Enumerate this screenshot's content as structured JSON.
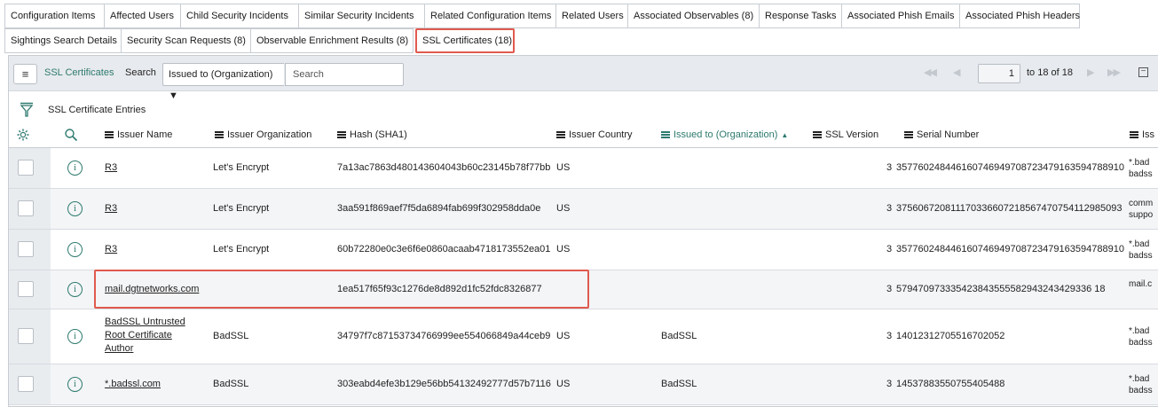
{
  "tabs_row1": [
    {
      "label": "Configuration Items",
      "w": 113
    },
    {
      "label": "Affected Users",
      "w": 86
    },
    {
      "label": "Child Security Incidents",
      "w": 133
    },
    {
      "label": "Similar Security Incidents",
      "w": 142
    },
    {
      "label": "Related Configuration Items",
      "w": 148
    },
    {
      "label": "Related Users",
      "w": 81
    },
    {
      "label": "Associated Observables (8)",
      "w": 148
    },
    {
      "label": "Response Tasks",
      "w": 93
    },
    {
      "label": "Associated Phish Emails",
      "w": 133
    },
    {
      "label": "Associated Phish Headers",
      "w": 135
    }
  ],
  "tabs_row2": [
    {
      "label": "Sightings Search Details",
      "w": 132
    },
    {
      "label": "Security Scan Requests (8)",
      "w": 146
    },
    {
      "label": "Observable Enrichment Results (8)",
      "w": 183
    },
    {
      "label": "SSL Certificates (18)",
      "w": 112,
      "active": true
    }
  ],
  "toolbar": {
    "list_title": "SSL Certificates",
    "search_label": "Search",
    "search_field": "Issued to (Organization)",
    "search_placeholder": "Search",
    "page_number": "1",
    "page_range": "to 18 of 18"
  },
  "list": {
    "entries_title": "SSL Certificate Entries",
    "columns": [
      "Issuer Name",
      "Issuer Organization",
      "Hash (SHA1)",
      "Issuer Country",
      "Issued to (Organization)",
      "SSL Version",
      "Serial Number",
      "Iss"
    ],
    "rows": [
      {
        "issuer_name": "R3",
        "issuer_org": "Let's Encrypt",
        "hash": "7a13ac7863d480143604043b60c23145b78f77bb",
        "country": "US",
        "issued_to": "",
        "version": "3",
        "serial": "357760248446160746949708723479163594788910",
        "extra": "*.bad\nbadss"
      },
      {
        "issuer_name": "R3",
        "issuer_org": "Let's Encrypt",
        "hash": "3aa591f869aef7f5da6894fab699f302958dda0e",
        "country": "US",
        "issued_to": "",
        "version": "3",
        "serial": "375606720811170336607218567470754112985093",
        "extra": "comm\nsuppo"
      },
      {
        "issuer_name": "R3",
        "issuer_org": "Let's Encrypt",
        "hash": "60b72280e0c3e6f6e0860acaab4718173552ea01",
        "country": "US",
        "issued_to": "",
        "version": "3",
        "serial": "357760248446160746949708723479163594788910",
        "extra": "*.bad\nbadss"
      },
      {
        "issuer_name": "mail.dgtnetworks.com",
        "issuer_org": "",
        "hash": "1ea517f65f93c1276de8d892d1fc52fdc8326877",
        "country": "",
        "issued_to": "",
        "version": "3",
        "serial": "579470973335423843555582943243429336 18",
        "extra": "mail.c"
      },
      {
        "issuer_name": "BadSSL Untrusted Root Certificate Author",
        "issuer_org": "BadSSL",
        "hash": "34797f7c87153734766999ee554066849a44ceb9",
        "country": "US",
        "issued_to": "BadSSL",
        "version": "3",
        "serial": "14012312705516702052",
        "extra": "*.bad\nbadss"
      },
      {
        "issuer_name": "*.badssl.com",
        "issuer_org": "BadSSL",
        "hash": "303eabd4efe3b129e56bb54132492777d57b7116",
        "country": "US",
        "issued_to": "BadSSL",
        "version": "3",
        "serial": "14537883550755405488",
        "extra": "*.bad\nbadss"
      }
    ]
  },
  "colors": {
    "accent": "#2d7a6e",
    "highlight": "#e05a4e",
    "toolbar_bg": "#e7eaee"
  }
}
